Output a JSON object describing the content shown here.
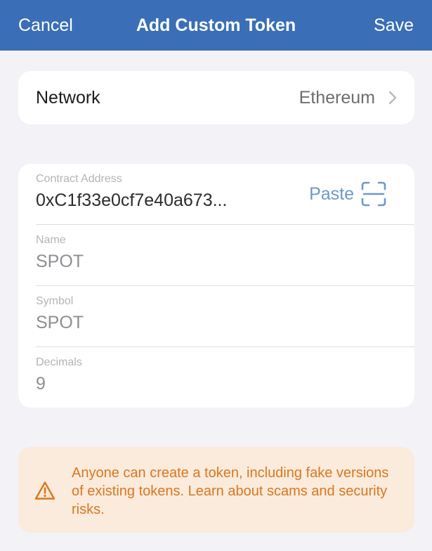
{
  "navbar": {
    "cancel_label": "Cancel",
    "title": "Add Custom Token",
    "save_label": "Save"
  },
  "network": {
    "label": "Network",
    "value": "Ethereum"
  },
  "fields": {
    "contract_address": {
      "label": "Contract Address",
      "value": "0xC1f33e0cf7e40a673..."
    },
    "paste_label": "Paste",
    "name": {
      "label": "Name",
      "value": "SPOT"
    },
    "symbol": {
      "label": "Symbol",
      "value": "SPOT"
    },
    "decimals": {
      "label": "Decimals",
      "value": "9"
    }
  },
  "warning": {
    "text": "Anyone can create a token, including fake versions of existing tokens. Learn about scams and security risks."
  },
  "icons": {
    "scan": "qr-scan-icon",
    "chevron": "chevron-right-icon",
    "warning": "warning-triangle-icon"
  },
  "colors": {
    "navbar": "#3a6fb7",
    "accent": "#6f97cf",
    "warning_bg": "#faebdc",
    "warning_text": "#d9771f"
  }
}
